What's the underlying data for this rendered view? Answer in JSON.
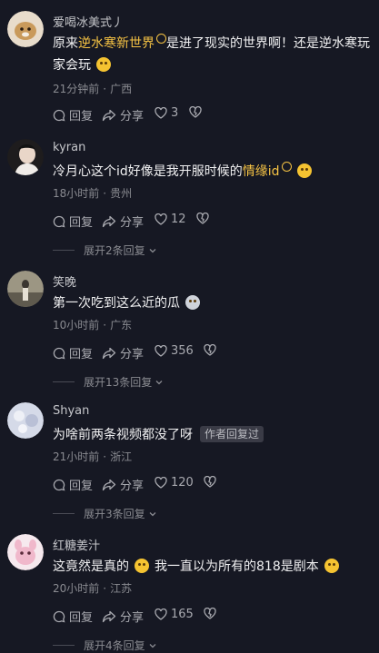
{
  "comments": [
    {
      "username": "爱喝冰美式丿",
      "text_before": "原来",
      "highlight": "逆水寒新世界",
      "text_after": "是进了现实的世界啊！还是逆水寒玩家会玩",
      "time": "21分钟前",
      "location": "广西",
      "reply_label": "回复",
      "share_label": "分享",
      "likes": "3",
      "avatar_color": "#d9b27c"
    },
    {
      "username": "kyran",
      "text_before": "冷月心这个id好像是我开服时候的",
      "highlight": "情缘id",
      "text_after": "",
      "time": "18小时前",
      "location": "贵州",
      "reply_label": "回复",
      "share_label": "分享",
      "likes": "12",
      "expand": "展开2条回复",
      "avatar_color": "#3a3436"
    },
    {
      "username": "笑晚",
      "text_before": "第一次吃到这么近的瓜",
      "time": "10小时前",
      "location": "广东",
      "reply_label": "回复",
      "share_label": "分享",
      "likes": "356",
      "expand": "展开13条回复",
      "avatar_color": "#8a8576"
    },
    {
      "username": "Shyan",
      "text_before": "为啥前两条视频都没了呀",
      "author_badge": "作者回复过",
      "time": "21小时前",
      "location": "浙江",
      "reply_label": "回复",
      "share_label": "分享",
      "likes": "120",
      "expand": "展开3条回复",
      "avatar_color": "#c9cfe0"
    },
    {
      "username": "红糖姜汁",
      "text_before": "这竟然是真的",
      "text_middle": "我一直以为所有的818是剧本",
      "time": "20小时前",
      "location": "江苏",
      "reply_label": "回复",
      "share_label": "分享",
      "likes": "165",
      "expand": "展开4条回复",
      "avatar_color": "#e6b3c4"
    }
  ]
}
